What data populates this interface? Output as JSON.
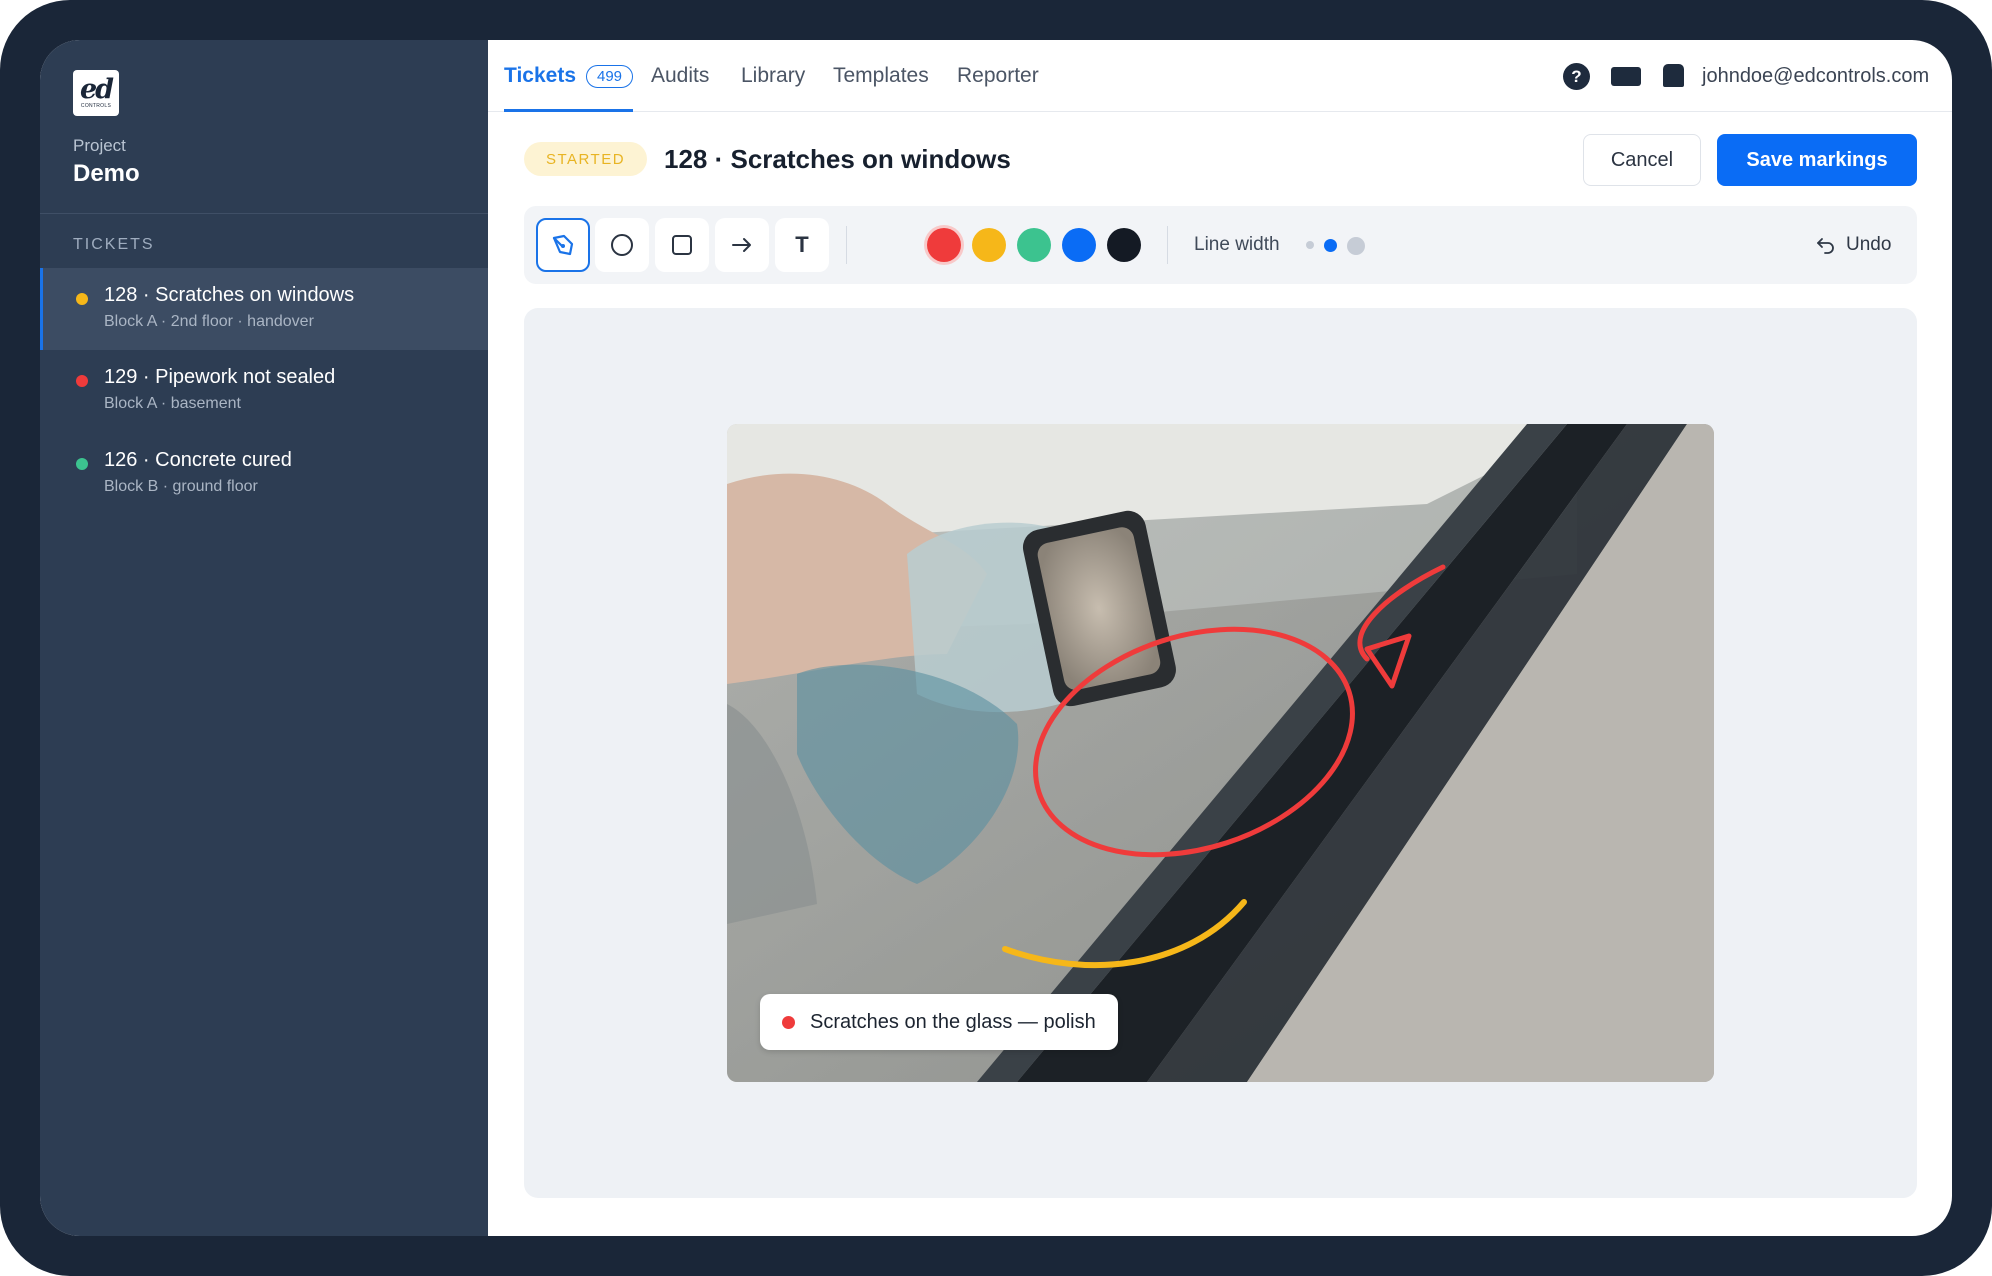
{
  "brand": {
    "logo_text": "ed",
    "logo_subtext": "CONTROLS"
  },
  "sidebar": {
    "project_label": "Project",
    "project_name": "Demo",
    "section_label": "TICKETS",
    "tickets": [
      {
        "title": "128 · Scratches on windows",
        "subtitle": "Block A · 2nd floor · handover",
        "status_color": "#f6b719",
        "active": true
      },
      {
        "title": "129 · Pipework not sealed",
        "subtitle": "Block A · basement",
        "status_color": "#ef3b3b",
        "active": false
      },
      {
        "title": "126 · Concrete cured",
        "subtitle": "Block B · ground floor",
        "status_color": "#3cc38f",
        "active": false
      }
    ]
  },
  "nav": {
    "tabs": [
      {
        "label": "Tickets",
        "badge": "499",
        "active": true
      },
      {
        "label": "Audits"
      },
      {
        "label": "Library"
      },
      {
        "label": "Templates"
      },
      {
        "label": "Reporter"
      }
    ],
    "icons": [
      "help-icon",
      "mail-icon",
      "bell-icon"
    ],
    "help_glyph": "?",
    "user_email": "johndoe@edcontrols.com"
  },
  "header": {
    "status": "STARTED",
    "title": "128 · Scratches on windows",
    "cancel_label": "Cancel",
    "save_label": "Save markings"
  },
  "toolbar": {
    "tools": [
      "pen-icon",
      "circle-icon",
      "rectangle-icon",
      "arrow-icon",
      "text-icon"
    ],
    "active_tool": "pen-icon",
    "text_tool_glyph": "T",
    "colors": [
      "#ef3b3b",
      "#f6b719",
      "#3cc38f",
      "#0a6cf5",
      "#141a24"
    ],
    "selected_color": "#ef3b3b",
    "line_width_label": "Line width",
    "line_width_options": [
      "thin",
      "medium",
      "thick"
    ],
    "line_width_selected": "medium",
    "undo_label": "Undo"
  },
  "canvas": {
    "annotation_text": "Scratches on the glass — polish",
    "annotation_color": "#ef3b3b"
  },
  "colors": {
    "accent": "#1a73e8",
    "sidebar_bg": "#2d3d53",
    "status_started": "#e8b423"
  }
}
